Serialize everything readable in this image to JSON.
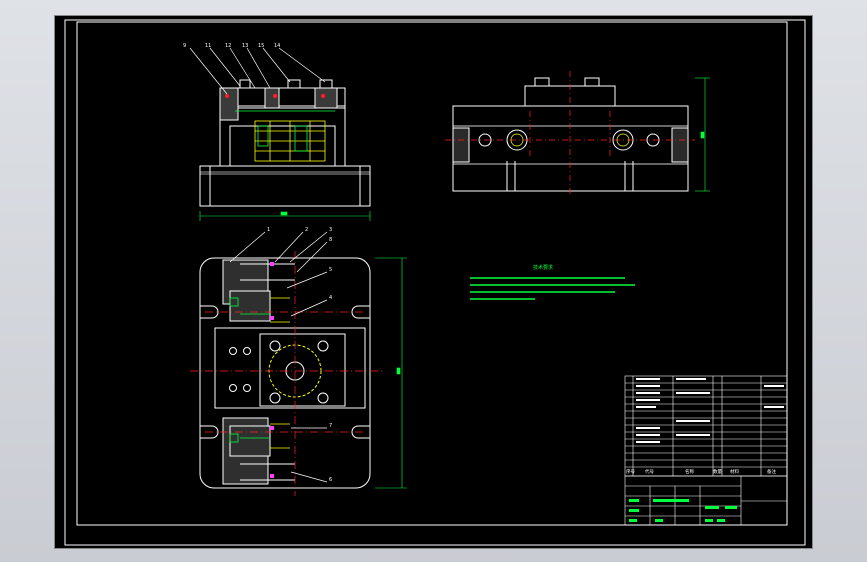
{
  "drawing": {
    "tech_title": "技术要求",
    "tech_lines": [
      "1.",
      "2.",
      "3.",
      "4."
    ],
    "balloons_front": [
      "9",
      "11",
      "12",
      "13",
      "15",
      "14"
    ],
    "balloons_plan": [
      "1",
      "2",
      "3",
      "8",
      "5",
      "4",
      "7",
      "6"
    ],
    "bom_header": [
      "序号",
      "代号",
      "名称",
      "数量",
      "材料",
      "备注"
    ]
  },
  "colors": {
    "sheet": "#000000",
    "frame": "#ffffff",
    "green": "#00ff3c",
    "yellow": "#ffff00",
    "red": "#ff2020",
    "magenta": "#ff40ff",
    "cyan": "#00ffff"
  }
}
